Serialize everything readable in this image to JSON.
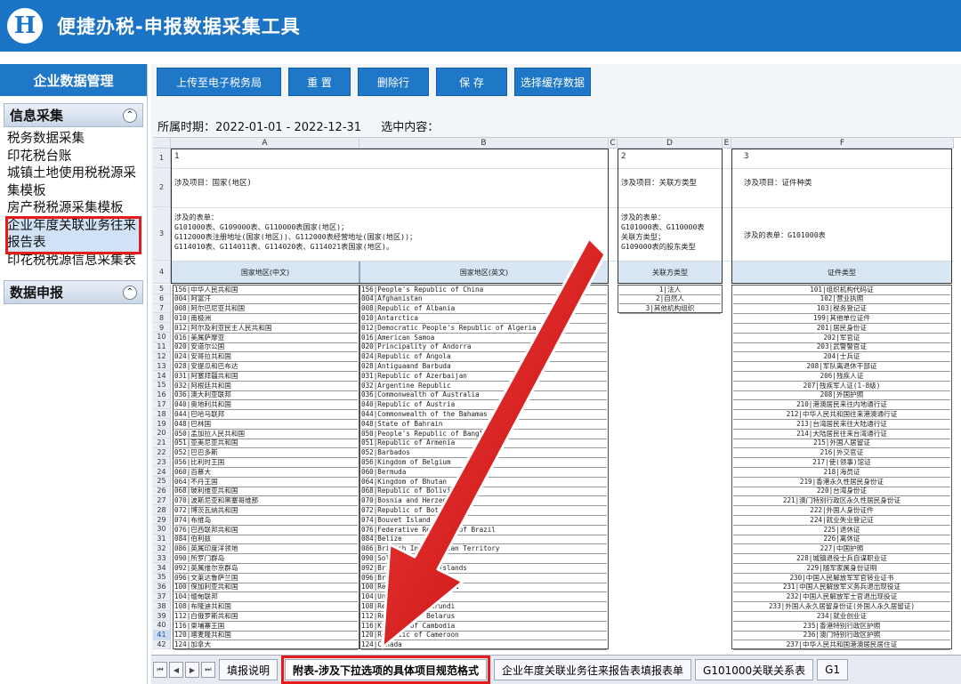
{
  "app": {
    "title": "便捷办税-申报数据采集工具",
    "logo_letter": "H"
  },
  "sidebar": {
    "header": "企业数据管理",
    "sections": [
      {
        "title": "信息采集",
        "items": [
          "税务数据采集",
          "印花税台账",
          "城镇土地使用税税源采集模板",
          "房产税税源采集模板",
          "企业年度关联业务往来报告表",
          "印花税税源信息采集表"
        ]
      },
      {
        "title": "数据申报",
        "items": []
      }
    ],
    "collapse_icon": "⌃"
  },
  "toolbar": {
    "buttons": [
      "上传至电子税务局",
      "重 置",
      "删除行",
      "保 存",
      "选择缓存数据"
    ]
  },
  "period": {
    "text": "所属时期：2022-01-01 - 2022-12-31",
    "selected": "选中内容："
  },
  "grid": {
    "columns": [
      "",
      "A",
      "B",
      "C",
      "D",
      "E",
      "F",
      "G"
    ],
    "row1": [
      "1",
      "2",
      "3"
    ],
    "row2": [
      "涉及项目：国家(地区)",
      "涉及项目：关联方类型",
      "涉及项目：证件种类"
    ],
    "row3": [
      "涉及的表单：\nG101000表、G109000表、G110000表国家(地区)；\nG112000表注册地址(国家(地区))、G112000表经营地址(国家(地区))；\nG114010表、G114011表、G114020表、G114021表国家(地区)。",
      "涉及的表单：\nG101000表、G110000表\n关联方类型；\nG109000表的股东类型",
      "涉及的表单：G101000表"
    ],
    "row4": [
      "国家地区(中文)",
      "国家地区(英文)",
      "关联方类型",
      "证件类型"
    ],
    "rownums": [
      "5",
      "6",
      "7",
      "8",
      "9",
      "10",
      "11",
      "12",
      "13",
      "14",
      "15",
      "16",
      "17",
      "18",
      "19",
      "20",
      "21",
      "22",
      "23",
      "24",
      "25",
      "26",
      "27",
      "28",
      "29",
      "30",
      "31",
      "32",
      "33",
      "34",
      "35",
      "36",
      "37",
      "38",
      "39",
      "40",
      "41",
      "42"
    ],
    "countries_cn": [
      "156|中华人民共和国",
      "004|阿富汗",
      "008|阿尔巴尼亚共和国",
      "010|南极洲",
      "012|阿尔及利亚民主人民共和国",
      "016|美属萨摩亚",
      "020|安道尔公国",
      "024|安哥拉共和国",
      "028|安提瓜和巴布达",
      "031|阿塞拜疆共和国",
      "032|阿根廷共和国",
      "036|澳大利亚联邦",
      "040|奥地利共和国",
      "044|巴哈马联邦",
      "048|巴林国",
      "050|孟加拉人民共和国",
      "051|亚美尼亚共和国",
      "052|巴巴多斯",
      "056|比利时王国",
      "060|百慕大",
      "064|不丹王国",
      "068|玻利维亚共和国",
      "070|波斯尼亚和黑塞哥维那",
      "072|博茨瓦纳共和国",
      "074|布维岛",
      "076|巴西联邦共和国",
      "084|伯利兹",
      "086|英属印度洋领地",
      "090|所罗门群岛",
      "092|英属维尔京群岛",
      "096|文莱达鲁萨兰国",
      "100|保加利亚共和国",
      "104|缅甸联邦",
      "108|布隆迪共和国",
      "112|白俄罗斯共和国",
      "116|柬埔寨王国",
      "120|喀麦隆共和国",
      "124|加拿大"
    ],
    "countries_en": [
      "156|People's Republic of China",
      "004|Afghanistan",
      "008|Republic of Albania",
      "010|Antarctica",
      "012|Democratic People's Republic of Algeria",
      "016|American Samoa",
      "020|Principality of Andorra",
      "024|Republic of Angola",
      "028|Antiguaand Barbuda",
      "031|Republic of Azerbaijan",
      "032|Argentine Republic",
      "036|Commonwealth of Australia",
      "040|Republic of Austria",
      "044|Commonwealth of the Bahamas",
      "048|State of Bahrain",
      "050|People's Republic of Bangladesh",
      "051|Republic of Armenia",
      "052|Barbados",
      "056|Kingdom of Belgium",
      "060|Bermuda",
      "064|Kingdom of Bhutan",
      "068|Republic of Bolivia",
      "070|Bosnia and Herzegovina",
      "072|Republic of Botswana",
      "074|Bouvet Island",
      "076|Federative Republic of Brazil",
      "084|Belize",
      "086|British Indian Ocean Territory",
      "090|Solomon Islands",
      "092|British Virgin Islands",
      "096|Brunei Darussalam",
      "100|Republic of Bulgaria",
      "104|Union of Myanmar",
      "108|Republic of Burundi",
      "112|Republic of Belarus",
      "116|Kingdom of Cambodia",
      "120|Republic of Cameroon",
      "124|Canada"
    ],
    "party_types": [
      "1|法人",
      "2|自然人",
      "3|其他机构组织"
    ],
    "id_types": [
      "101|组织机构代码证",
      "102|营业执照",
      "103|税务登记证",
      "199|其他单位证件",
      "201|居民身份证",
      "202|军官证",
      "203|武警警官证",
      "204|士兵证",
      "208|军队离退休干部证",
      "206|残疾人证",
      "207|残疾军人证(1-8级)",
      "208|外国护照",
      "210|港澳居民来往内地通行证",
      "212|中华人民共和国往来港澳通行证",
      "213|台湾居民来往大陆通行证",
      "214|大陆居民往来台湾通行证",
      "215|外国人居留证",
      "216|外交官证",
      "217|使(领事)馆证",
      "218|海员证",
      "219|香港永久性居民身份证",
      "220|台湾身份证",
      "221|澳门特别行政区永久性居民身份证",
      "222|外国人身份证件",
      "224|就业失业登记证",
      "225|退休证",
      "226|离休证",
      "227|中国护照",
      "228|城镇退役士兵自谋职业证",
      "229|随军家属身份证明",
      "230|中国人民解放军军官转业证书",
      "231|中国人民解放军义务兵退出现役证",
      "232|中国人民解放军士官退出现役证",
      "233|外国人永久居留身份证(外国人永久居留证)",
      "234|就业创业证",
      "235|香港特别行政区护照",
      "236|澳门特别行政区护照",
      "237|中华人民共和国港澳居民居住证"
    ]
  },
  "tabs": {
    "items": [
      "填报说明",
      "附表-涉及下拉选项的具体项目规范格式",
      "企业年度关联业务往来报告表填报表单",
      "G101000关联关系表",
      "G1"
    ],
    "active_index": 1,
    "nav_glyphs": [
      "⏮",
      "◀",
      "▶",
      "⏭"
    ]
  }
}
